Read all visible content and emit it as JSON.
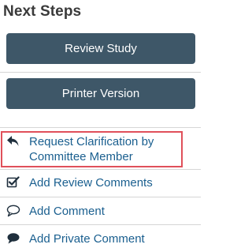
{
  "panel": {
    "title": "Next Steps"
  },
  "buttons": {
    "review_study": "Review Study",
    "printer_version": "Printer Version"
  },
  "actions": [
    {
      "label_line1": "Request Clarification by",
      "label_line2": "Committee Member",
      "icon": "reply-arrow-icon",
      "highlighted": true
    },
    {
      "label": "Add Review Comments",
      "icon": "checkbox-checked-icon"
    },
    {
      "label": "Add Comment",
      "icon": "speech-bubble-outline-icon"
    },
    {
      "label": "Add Private Comment",
      "icon": "speech-bubble-filled-icon"
    }
  ],
  "colors": {
    "button_bg": "#3e5768",
    "link": "#1a5f8f",
    "highlight_border": "#e0505a",
    "heading": "#3a3a3a"
  }
}
